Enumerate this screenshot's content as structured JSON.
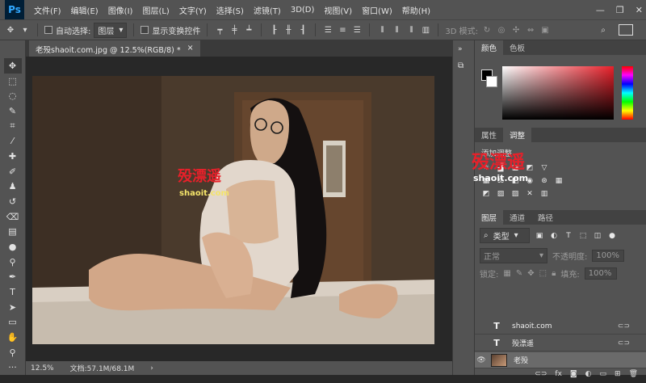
{
  "app": {
    "logo": "Ps"
  },
  "menu": [
    "文件(F)",
    "编辑(E)",
    "图像(I)",
    "图层(L)",
    "文字(Y)",
    "选择(S)",
    "滤镜(T)",
    "3D(D)",
    "视图(V)",
    "窗口(W)",
    "帮助(H)"
  ],
  "options": {
    "auto_select_label": "自动选择:",
    "auto_select_value": "图层",
    "show_transform_label": "显示变换控件",
    "mode_3d_label": "3D 模式:"
  },
  "document": {
    "tab_title": "老殁shaoit.com.jpg @ 12.5%(RGB/8) *",
    "close": "×",
    "watermark_main": "殁漂遥",
    "watermark_sub": "shaoit.com"
  },
  "status": {
    "zoom": "12.5%",
    "doc_info": "文档:57.1M/68.1M"
  },
  "panels": {
    "color_tabs": [
      "颜色",
      "色板"
    ],
    "props_tabs": [
      "属性",
      "调整"
    ],
    "add_adjustment": "添加调整",
    "overlay_main": "殁漂遥",
    "overlay_sub": "shaoit.com",
    "layer_tabs": [
      "图层",
      "通道",
      "路径"
    ],
    "kind_filter": "类型",
    "blend_mode": "正常",
    "opacity_label": "不透明度:",
    "opacity_value": "100%",
    "lock_label": "锁定:",
    "fill_label": "填充:",
    "fill_value": "100%",
    "layers": [
      {
        "name": "shaoit.com",
        "type": "T"
      },
      {
        "name": "殁漂遥",
        "type": "T"
      },
      {
        "name": "老殁",
        "type": "image"
      }
    ]
  },
  "colors": {
    "accent": "#31a8ff",
    "watermark_red": "#e8202a",
    "watermark_blue": "#1a66c8"
  }
}
